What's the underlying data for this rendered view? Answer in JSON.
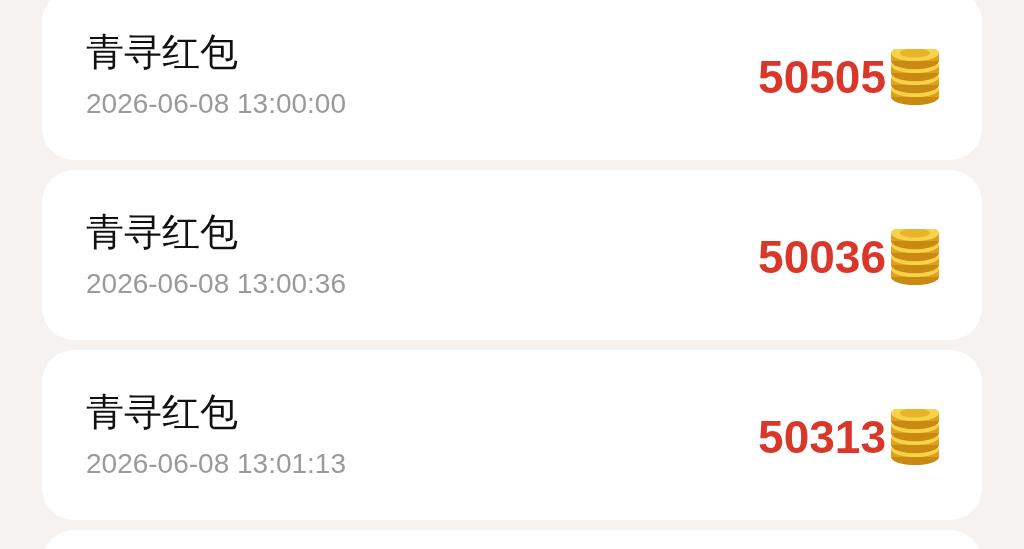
{
  "records": [
    {
      "title": "青寻红包",
      "time": "2026-06-08 13:00:00",
      "amount": "50505"
    },
    {
      "title": "青寻红包",
      "time": "2026-06-08 13:00:36",
      "amount": "50036"
    },
    {
      "title": "青寻红包",
      "time": "2026-06-08 13:01:13",
      "amount": "50313"
    }
  ]
}
